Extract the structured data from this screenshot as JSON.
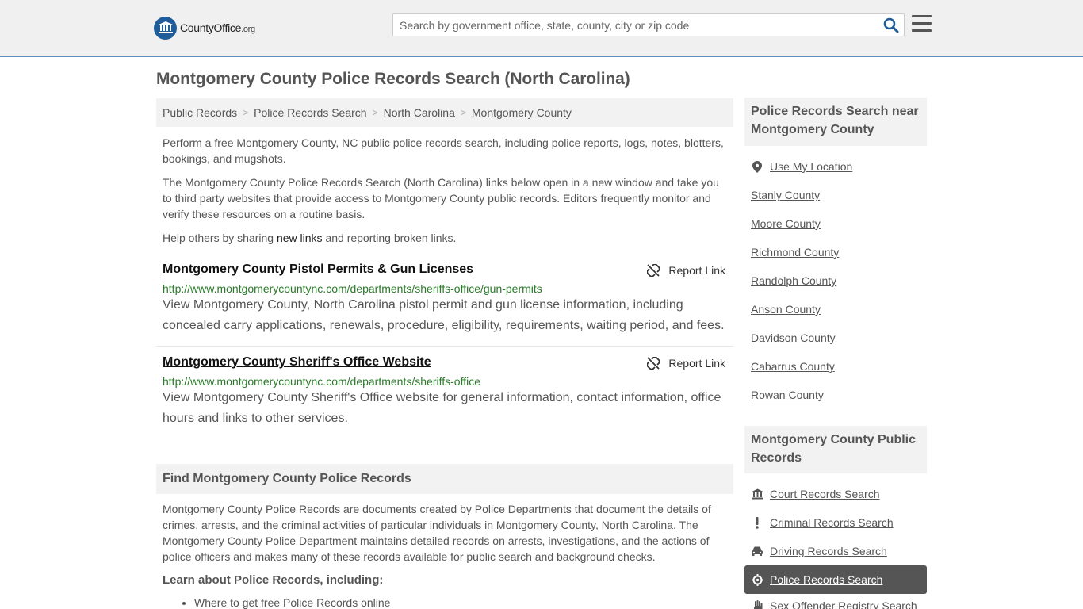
{
  "header": {
    "logo_main": "CountyOffice",
    "logo_suffix": ".org",
    "search_placeholder": "Search by government office, state, county, city or zip code"
  },
  "page_title": "Montgomery County Police Records Search (North Carolina)",
  "breadcrumb": [
    "Public Records",
    "Police Records Search",
    "North Carolina",
    "Montgomery County"
  ],
  "intro": {
    "p1": "Perform a free Montgomery County, NC public police records search, including police reports, logs, notes, blotters, bookings, and mugshots.",
    "p2": "The Montgomery County Police Records Search (North Carolina) links below open in a new window and take you to third party websites that provide access to Montgomery County public records. Editors frequently monitor and verify these resources on a routine basis.",
    "p3_before": "Help others by sharing ",
    "p3_link": "new links",
    "p3_after": " and reporting broken links."
  },
  "entries": [
    {
      "title": "Montgomery County Pistol Permits & Gun Licenses",
      "report_label": "Report Link",
      "url": "http://www.montgomerycountync.com/departments/sheriffs-office/gun-permits",
      "description": "View Montgomery County, North Carolina pistol permit and gun license information, including concealed carry applications, renewals, procedure, eligibility, requirements, waiting period, and fees."
    },
    {
      "title": "Montgomery County Sheriff's Office Website",
      "report_label": "Report Link",
      "url": "http://www.montgomerycountync.com/departments/sheriffs-office",
      "description": "View Montgomery County Sheriff's Office website for general information, contact information, office hours and links to other services."
    }
  ],
  "find_section": {
    "title": "Find Montgomery County Police Records",
    "text": "Montgomery County Police Records are documents created by Police Departments that document the details of crimes, arrests, and the criminal activities of particular individuals in Montgomery County, North Carolina. The Montgomery County Police Department maintains detailed records on arrests, investigations, and the actions of police officers and makes many of these records available for public search and background checks.",
    "learn_title": "Learn about Police Records, including:",
    "learn_items": [
      "Where to get free Police Records online"
    ]
  },
  "sidebar": {
    "nearby_title": "Police Records Search near Montgomery County",
    "use_location": "Use My Location",
    "nearby": [
      "Stanly County",
      "Moore County",
      "Richmond County",
      "Randolph County",
      "Anson County",
      "Davidson County",
      "Cabarrus County",
      "Rowan County"
    ],
    "public_title": "Montgomery County Public Records",
    "public_links": [
      {
        "label": "Court Records Search",
        "icon": "courthouse-icon"
      },
      {
        "label": "Criminal Records Search",
        "icon": "exclamation-icon"
      },
      {
        "label": "Driving Records Search",
        "icon": "car-icon"
      },
      {
        "label": "Police Records Search",
        "icon": "crosshair-icon"
      },
      {
        "label": "Sex Offender Registry Search",
        "icon": "hand-icon"
      }
    ]
  },
  "colors": {
    "accent": "#5b8ec6",
    "logo_blue": "#1f5c99",
    "url_green": "#2a7a2a",
    "active_bg": "#555555"
  }
}
